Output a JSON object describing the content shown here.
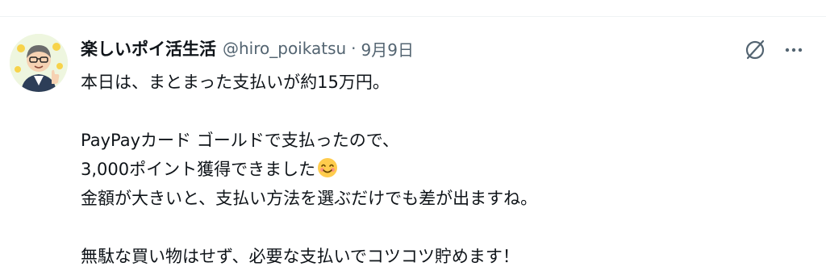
{
  "post": {
    "display_name": "楽しいポイ活生活",
    "handle": "@hiro_poikatsu",
    "separator": "·",
    "date": "9月9日",
    "lines": [
      "本日は、まとまった支払いが約15万円。",
      "",
      "PayPayカード ゴールドで支払ったので、",
      "3,000ポイント獲得できました",
      "金額が大きいと、支払い方法を選ぶだけでも差が出ますね。",
      "",
      "無駄な買い物はせず、必要な支払いでコツコツ貯めます！"
    ],
    "emoji": "smiling-face-with-smiling-eyes"
  },
  "icons": {
    "avatar": "avatar-illustration",
    "grok": "grok-slash-circle-icon",
    "more": "more-dots-icon"
  },
  "colors": {
    "text": "#0f1419",
    "secondary": "#536471",
    "divider": "#eff3f4"
  }
}
